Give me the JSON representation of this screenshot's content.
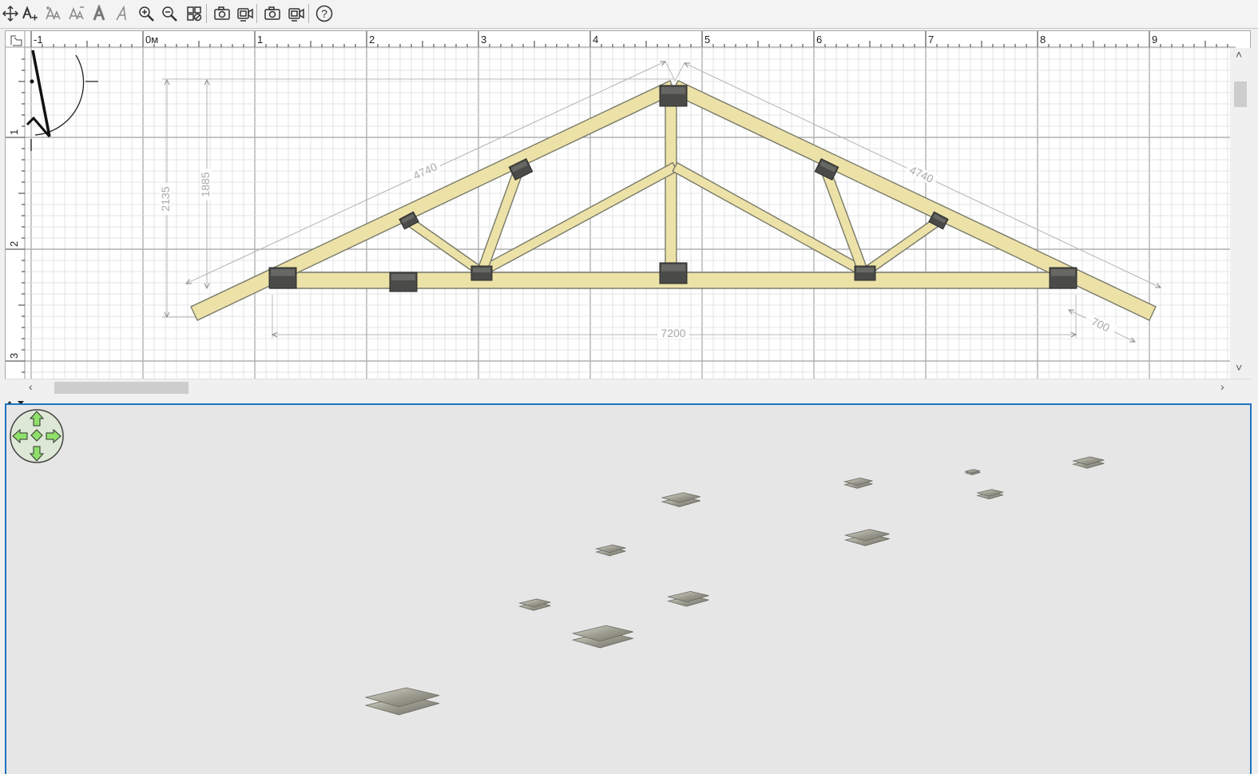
{
  "toolbar": {
    "buttons": [
      {
        "name": "move-tool-icon"
      },
      {
        "name": "add-text-icon",
        "glyph": "A+"
      },
      {
        "name": "font-size-up-icon",
        "glyph": "AA"
      },
      {
        "name": "font-size-down-icon",
        "glyph": "AA"
      },
      {
        "name": "bold-text-icon",
        "glyph": "A"
      },
      {
        "name": "italic-text-icon",
        "glyph": "A"
      },
      {
        "name": "zoom-in-icon"
      },
      {
        "name": "zoom-out-icon"
      },
      {
        "name": "layers-icon"
      },
      {
        "name": "camera-icon"
      },
      {
        "name": "video-camera-icon"
      },
      {
        "name": "camera-3d-icon"
      },
      {
        "name": "video-3d-icon"
      },
      {
        "name": "help-icon",
        "glyph": "?"
      }
    ]
  },
  "ruler": {
    "top_labels": [
      "-1",
      "0м",
      "1",
      "2",
      "3",
      "4",
      "5",
      "6",
      "7",
      "8",
      "9"
    ],
    "left_labels": [
      "1",
      "2",
      "3"
    ]
  },
  "dimensions": {
    "overall_height": "2135",
    "inner_height": "1885",
    "left_rafter": "4740",
    "right_rafter": "4740",
    "span": "7200",
    "overhang": "700"
  },
  "colors": {
    "timber_fill": "#ece2a8",
    "timber_stroke": "#7a7a6a",
    "plate": "#4a4a48",
    "grid_major": "#b0b0b0",
    "grid_minor": "#dcdcdc",
    "dim_line": "#b8b8b8",
    "view_border": "#1f74c3",
    "view_bg": "#e6e6e6",
    "nav_green": "#8ee06a"
  }
}
